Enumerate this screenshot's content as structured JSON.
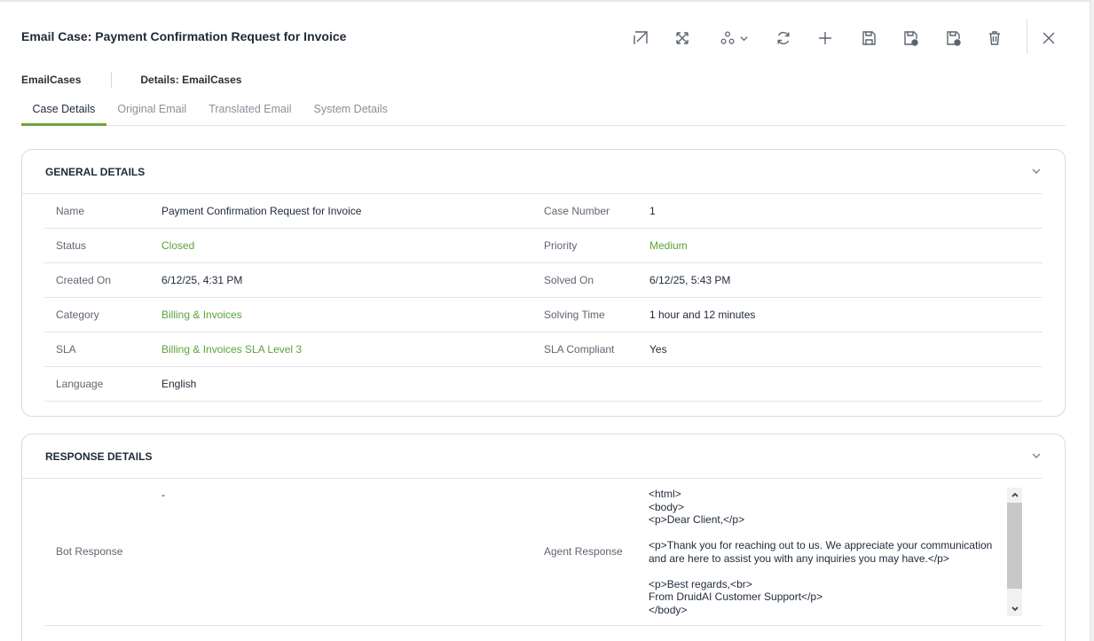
{
  "header": {
    "title": "Email Case: Payment Confirmation Request for Invoice"
  },
  "toolbar": {
    "icons": [
      "open-external-icon",
      "fullscreen-icon",
      "workflow-icon",
      "refresh-icon",
      "add-icon",
      "save-icon",
      "save-and-new-icon",
      "save-and-close-icon",
      "delete-icon",
      "close-icon"
    ]
  },
  "breadcrumb": {
    "root": "EmailCases",
    "current": "Details: EmailCases"
  },
  "tabs": [
    {
      "label": "Case Details",
      "active": true
    },
    {
      "label": "Original Email",
      "active": false
    },
    {
      "label": "Translated Email",
      "active": false
    },
    {
      "label": "System Details",
      "active": false
    }
  ],
  "general": {
    "heading": "GENERAL DETAILS",
    "rows": [
      {
        "label": "Name",
        "value": "Payment Confirmation Request for Invoice",
        "label2": "Case Number",
        "value2": "1"
      },
      {
        "label": "Status",
        "value": "Closed",
        "label2": "Priority",
        "value2": "Medium"
      },
      {
        "label": "Created On",
        "value": "6/12/25, 4:31 PM",
        "label2": "Solved On",
        "value2": "6/12/25, 5:43 PM"
      },
      {
        "label": "Category",
        "value": "Billing & Invoices",
        "label2": "Solving Time",
        "value2": "1 hour and 12 minutes"
      },
      {
        "label": "SLA",
        "value": "Billing & Invoices SLA Level 3",
        "label2": "SLA Compliant",
        "value2": "Yes"
      },
      {
        "label": "Language",
        "value": "English",
        "label2": "",
        "value2": ""
      }
    ]
  },
  "response": {
    "heading": "RESPONSE DETAILS",
    "bot_label": "Bot Response",
    "bot_value": "-",
    "agent_label": "Agent Response",
    "agent_value": "<html>\n<body>\n<p>Dear Client,</p>\n\n<p>Thank you for reaching out to us. We appreciate your communication and are here to assist you with any inquiries you may have.</p>\n\n<p>Best regards,<br>\nFrom DruidAI Customer Support</p>\n</body>"
  },
  "colors": {
    "accent_green": "#6ba539",
    "link_green": "#5aa33a"
  }
}
